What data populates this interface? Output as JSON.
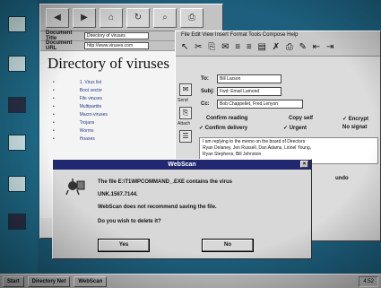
{
  "browser": {
    "address_rows": [
      {
        "label": "Document Title",
        "value": "Directory of viruses"
      },
      {
        "label": "Document URL",
        "value": "http://www.viruses.com"
      }
    ],
    "page_heading": "Directory of viruses",
    "tree": [
      {
        "text": "1. Virus list"
      },
      {
        "text": "Boot sector"
      },
      {
        "text": "File viruses"
      },
      {
        "text": "Multipartite"
      },
      {
        "text": "Macro viruses"
      },
      {
        "text": "Trojans"
      },
      {
        "text": "Worms"
      },
      {
        "text": "Hoaxes"
      }
    ]
  },
  "mail": {
    "menu_text": "File Edit View Insert Format Tools Compose Help",
    "toolbar_glyphs": "↖ ✂ ⎘ ✉  ≡ ≡ ▤   ✗ ⎙ ✎ ⇤ ⇥",
    "side_labels": [
      "Send",
      "Attach"
    ],
    "to": {
      "label": "To:",
      "value": "Bill Larson"
    },
    "subject": {
      "label": "Subj:",
      "value": "Fwd: Email Lamond"
    },
    "cc": {
      "label": "Cc:",
      "value": "Bob Chappellet, Fred Lenyon"
    },
    "options": {
      "confirm_reading": "Confirm reading",
      "confirm_delivery": "✓ Confirm delivery",
      "copy_self": "Copy self",
      "urgent": "✓ Urgent",
      "encrypt": "✓ Encrypt",
      "no_signature": "No signat"
    },
    "body_lines": [
      "I am replying to the memo on the board of Directors",
      "Ryan Delaney, Jen Russell, Dan Adams, Lionel Young,",
      "Ryan Stephens, Bill Johnston"
    ],
    "right_label": "undo"
  },
  "dialog": {
    "title": "WebScan",
    "line1": "The file E:\\T1\\MPCOMMAND_.EXE contains the virus",
    "line2": "UNK.1567.7144.",
    "line3": "WebScan does not recommend saving the file.",
    "question": "Do you wish to delete it?",
    "yes_label": "Yes",
    "no_label": "No"
  },
  "taskbar": {
    "start": "Start",
    "items": [
      "Directory Net",
      "WebScan"
    ],
    "clock": "4:52"
  }
}
